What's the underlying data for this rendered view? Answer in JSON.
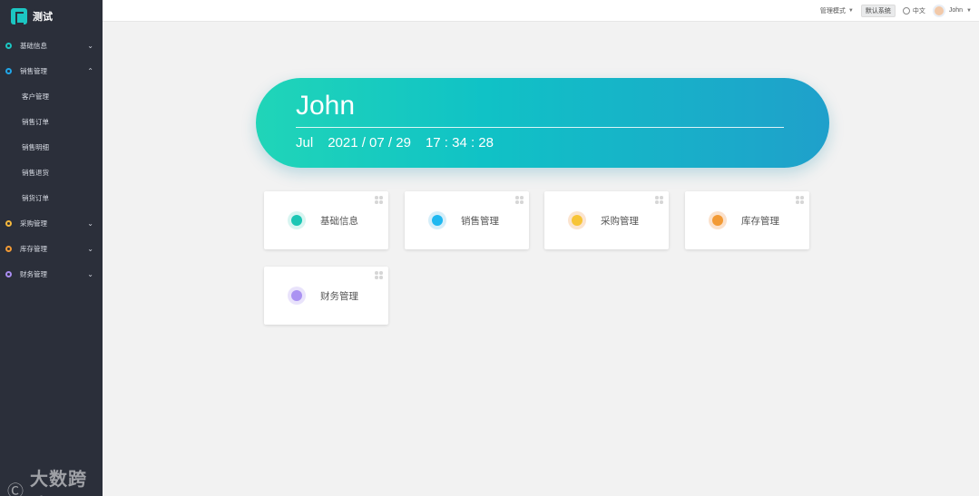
{
  "app": {
    "name": "测试"
  },
  "sidebar": {
    "items": [
      {
        "label": "基础信息",
        "color": "#1cc6c2",
        "expanded": false
      },
      {
        "label": "销售管理",
        "color": "#21a6e8",
        "expanded": true,
        "children": [
          "客户管理",
          "销售订单",
          "销售明细",
          "销售退货",
          "销货订单"
        ]
      },
      {
        "label": "采购管理",
        "color": "#f5b83d",
        "expanded": false
      },
      {
        "label": "库存管理",
        "color": "#f29a35",
        "expanded": false
      },
      {
        "label": "财务管理",
        "color": "#a98cf0",
        "expanded": false
      }
    ]
  },
  "topbar": {
    "mode": "管理模式",
    "system": "默认系统",
    "language": "中文",
    "user": "John"
  },
  "hero": {
    "name": "John",
    "month": "Jul",
    "date": "2021 / 07 / 29",
    "time": "17 : 34 : 28"
  },
  "modules": [
    {
      "label": "基础信息",
      "color": "#1cc6b4",
      "ring": "#d8f5f1"
    },
    {
      "label": "销售管理",
      "color": "#1fb8f0",
      "ring": "#d5eef9"
    },
    {
      "label": "采购管理",
      "color": "#f7c437",
      "ring": "#fbe4cf"
    },
    {
      "label": "库存管理",
      "color": "#f29a35",
      "ring": "#fbe1cb"
    },
    {
      "label": "财务管理",
      "color": "#ab93f2",
      "ring": "#e9e3fb"
    }
  ],
  "watermark": {
    "text": "大数跨境"
  }
}
